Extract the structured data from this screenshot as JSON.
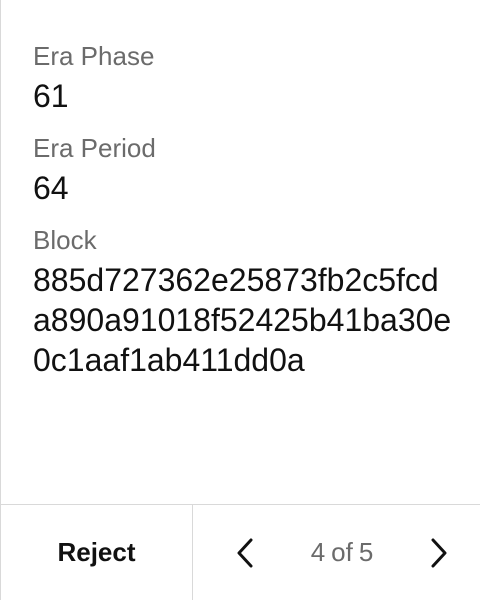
{
  "fields": [
    {
      "label": "Era Phase",
      "value": "61"
    },
    {
      "label": "Era Period",
      "value": "64"
    },
    {
      "label": "Block",
      "value": "885d727362e25873fb2c5fcda890a91018f52425b41ba30e0c1aaf1ab411dd0a"
    }
  ],
  "footer": {
    "reject_label": "Reject",
    "pagination": {
      "current": "4",
      "of_label": "of",
      "total": "5"
    },
    "icons": {
      "prev": "chevron-left-icon",
      "next": "chevron-right-icon"
    }
  },
  "colors": {
    "label": "#6b6b6b",
    "value": "#111111",
    "divider": "#d9d9d9",
    "background": "#ffffff"
  }
}
